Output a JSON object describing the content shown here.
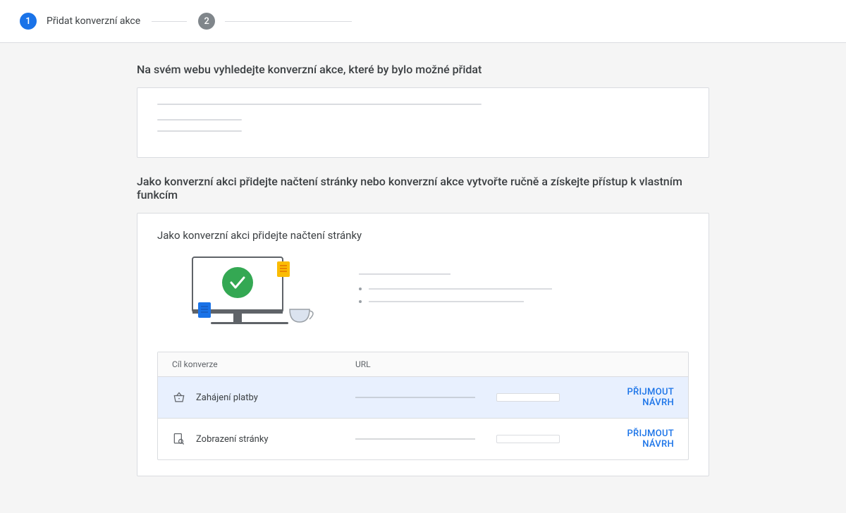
{
  "stepper": {
    "step1_number": "1",
    "step1_label": "Přidat konverzní akce",
    "step2_number": "2"
  },
  "section1": {
    "title": "Na svém webu vyhledejte konverzní akce, které by bylo možné přidat"
  },
  "section2": {
    "title": "Jako konverzní akci přidejte načtení stránky nebo konverzní akce vytvořte ručně a získejte přístup k vlastním funkcím",
    "subtitle": "Jako konverzní akci přidejte načtení stránky"
  },
  "table": {
    "headers": {
      "goal": "Cíl konverze",
      "url": "URL"
    },
    "rows": [
      {
        "goal": "Zahájení platby",
        "accept": "PŘIJMOUT NÁVRH",
        "highlight": true,
        "icon": "basket"
      },
      {
        "goal": "Zobrazení stránky",
        "accept": "PŘIJMOUT NÁVRH",
        "highlight": false,
        "icon": "page-search"
      }
    ]
  }
}
